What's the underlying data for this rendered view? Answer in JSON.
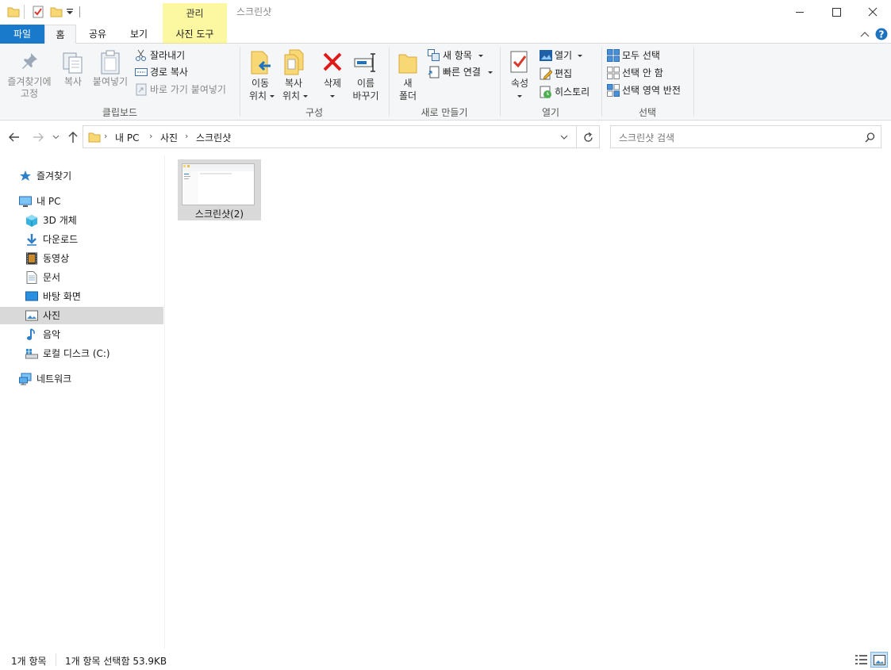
{
  "window": {
    "title": "스크린샷",
    "contextual_group": "관리"
  },
  "tabs": {
    "file": "파일",
    "home": "홈",
    "share": "공유",
    "view": "보기",
    "picture_tools": "사진 도구"
  },
  "ribbon": {
    "clipboard": {
      "pin_quick_access": [
        "즐겨찾기에",
        "고정"
      ],
      "copy": "복사",
      "paste": "붙여넣기",
      "cut": "잘라내기",
      "copy_path": "경로 복사",
      "paste_shortcut": "바로 가기 붙여넣기",
      "group_label": "클립보드"
    },
    "organize": {
      "move_to": [
        "이동",
        "위치"
      ],
      "copy_to": [
        "복사",
        "위치"
      ],
      "delete": "삭제",
      "rename": [
        "이름",
        "바꾸기"
      ],
      "group_label": "구성"
    },
    "new": {
      "new_folder": [
        "새",
        "폴더"
      ],
      "new_item": "새 항목",
      "easy_access": "빠른 연결",
      "group_label": "새로 만들기"
    },
    "open": {
      "properties": "속성",
      "open": "열기",
      "edit": "편집",
      "history": "히스토리",
      "group_label": "열기"
    },
    "select": {
      "select_all": "모두 선택",
      "select_none": "선택 안 함",
      "invert_selection": "선택 영역 반전",
      "group_label": "선택"
    }
  },
  "navbar": {
    "breadcrumb": [
      "내 PC",
      "사진",
      "스크린샷"
    ],
    "search_placeholder": "스크린샷 검색"
  },
  "sidebar": {
    "quick_access": "즐겨찾기",
    "this_pc": "내 PC",
    "items": [
      {
        "label": "3D 개체",
        "icon": "3d-objects-icon"
      },
      {
        "label": "다운로드",
        "icon": "downloads-icon"
      },
      {
        "label": "동영상",
        "icon": "videos-icon"
      },
      {
        "label": "문서",
        "icon": "documents-icon"
      },
      {
        "label": "바탕 화면",
        "icon": "desktop-icon"
      },
      {
        "label": "사진",
        "icon": "pictures-icon",
        "selected": true
      },
      {
        "label": "음악",
        "icon": "music-icon"
      },
      {
        "label": "로컬 디스크 (C:)",
        "icon": "local-disk-icon"
      }
    ],
    "network": "네트워크"
  },
  "files": [
    {
      "name": "스크린샷(2)",
      "selected": true
    }
  ],
  "status": {
    "item_count": "1개 항목",
    "selection": "1개 항목 선택함 53.9KB"
  },
  "colors": {
    "file_tab": "#1979ca",
    "contextual_tab": "#fcf7a1",
    "selection": "#d9d9d9",
    "help": "#1e73be",
    "delete_x": "#e01919",
    "folder_yellow": "#f8d775"
  }
}
